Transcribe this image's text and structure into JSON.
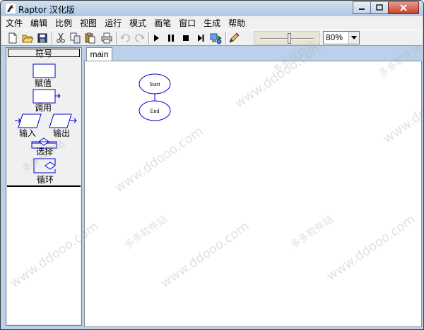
{
  "window": {
    "title": "Raptor 汉化版"
  },
  "menu": {
    "items": [
      "文件",
      "编辑",
      "比例",
      "视图",
      "运行",
      "模式",
      "画笔",
      "窗口",
      "生成",
      "帮助"
    ]
  },
  "toolbar": {
    "buttons": [
      {
        "name": "new-file-icon"
      },
      {
        "name": "open-folder-icon"
      },
      {
        "name": "save-icon"
      },
      {
        "name": "cut-icon"
      },
      {
        "name": "copy-icon"
      },
      {
        "name": "paste-icon"
      },
      {
        "name": "print-icon"
      },
      {
        "name": "undo-icon"
      },
      {
        "name": "redo-icon"
      },
      {
        "name": "play-icon"
      },
      {
        "name": "pause-icon"
      },
      {
        "name": "stop-icon"
      },
      {
        "name": "step-icon"
      },
      {
        "name": "test-server-icon"
      },
      {
        "name": "pen-icon"
      }
    ],
    "zoom": {
      "level": 0.55,
      "value": "80%"
    }
  },
  "palette": {
    "header": "符号",
    "symbols": {
      "assignment": "赋值",
      "call": "调用",
      "input": "输入",
      "output": "输出",
      "selection": "选择",
      "loop": "循环"
    }
  },
  "tabs": [
    {
      "label": "main"
    }
  ],
  "flowchart": {
    "start_label": "Start",
    "end_label": "End",
    "stroke_color": "#0000cc"
  },
  "watermarks": [
    "多多软件站",
    "www.ddooo.com"
  ],
  "colors": {
    "symbol_stroke": "#0000cc",
    "titlebar": "#b9d1ea",
    "face": "#f0f0f0"
  }
}
